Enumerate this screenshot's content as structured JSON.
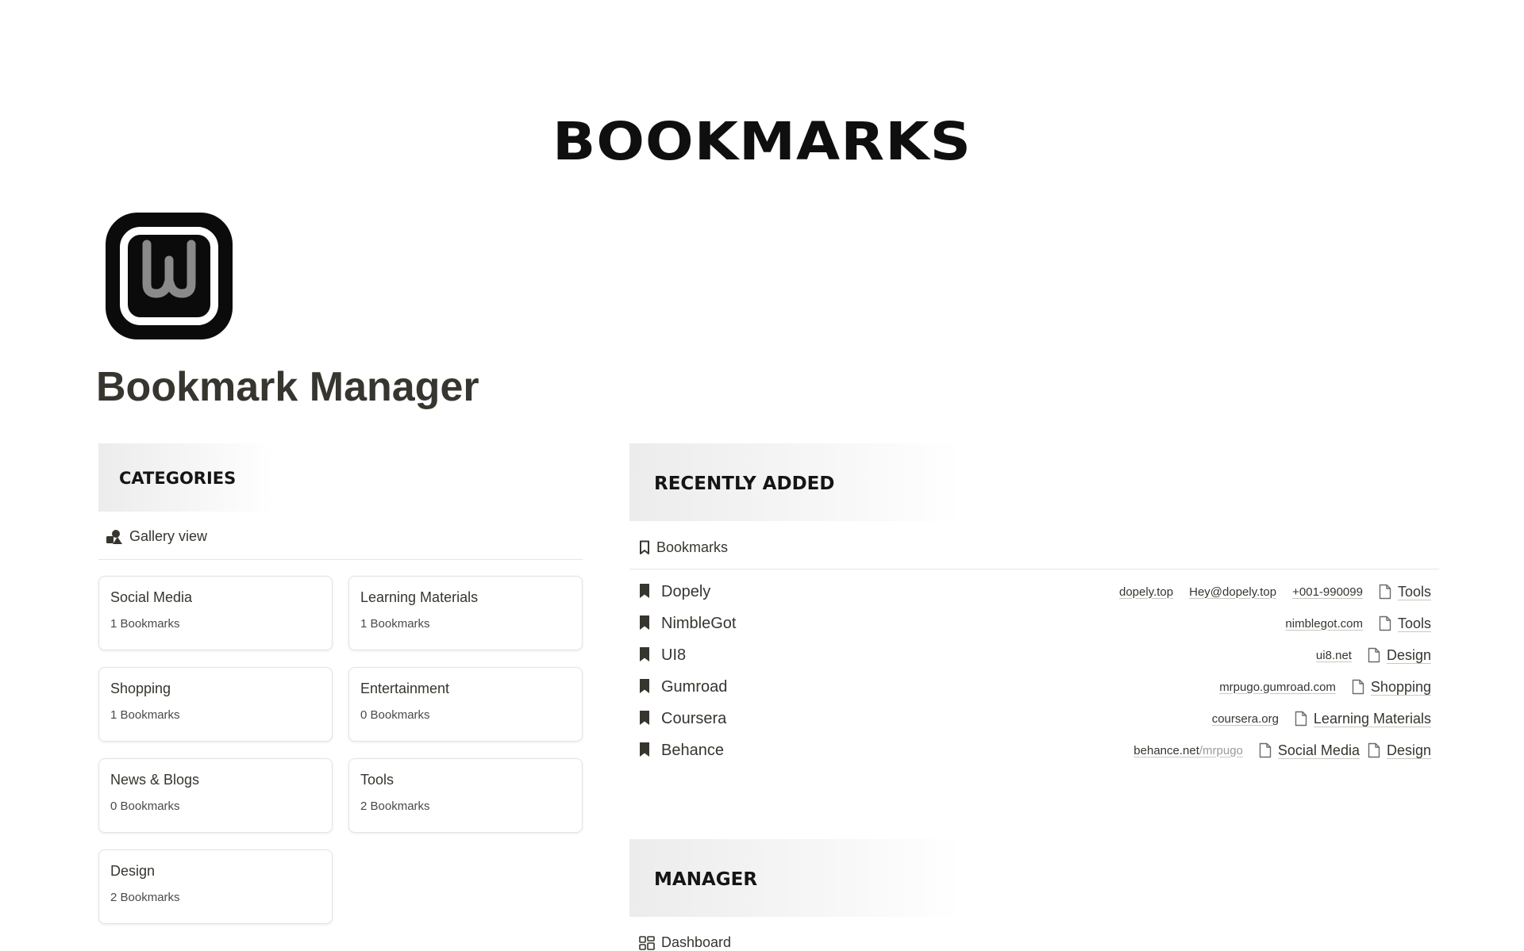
{
  "hero": {
    "title": "BOOKMARKS"
  },
  "page": {
    "title": "Bookmark Manager"
  },
  "categories": {
    "header": "CATEGORIES",
    "view_label": "Gallery view",
    "cards": [
      {
        "title": "Social Media",
        "count": "1 Bookmarks"
      },
      {
        "title": "Learning Materials",
        "count": "1 Bookmarks"
      },
      {
        "title": "Shopping",
        "count": "1 Bookmarks"
      },
      {
        "title": "Entertainment",
        "count": "0 Bookmarks"
      },
      {
        "title": "News & Blogs",
        "count": "0 Bookmarks"
      },
      {
        "title": "Tools",
        "count": "2 Bookmarks"
      },
      {
        "title": "Design",
        "count": "2 Bookmarks"
      }
    ]
  },
  "recent": {
    "header": "RECENTLY ADDED",
    "view_label": "Bookmarks",
    "rows": [
      {
        "name": "Dopely",
        "url": "dopely.top",
        "email": "Hey@dopely.top",
        "phone": "+001-990099",
        "categories": [
          "Tools"
        ]
      },
      {
        "name": "NimbleGot",
        "url": "nimblegot.com",
        "categories": [
          "Tools"
        ]
      },
      {
        "name": "UI8",
        "url": "ui8.net",
        "categories": [
          "Design"
        ]
      },
      {
        "name": "Gumroad",
        "url": "mrpugo.gumroad.com",
        "categories": [
          "Shopping"
        ]
      },
      {
        "name": "Coursera",
        "url": "coursera.org",
        "categories": [
          "Learning Materials"
        ]
      },
      {
        "name": "Behance",
        "url": "behance.net",
        "url_suffix": "/mrpugo",
        "categories": [
          "Social Media",
          "Design"
        ]
      }
    ]
  },
  "manager": {
    "header": "MANAGER",
    "view_label": "Dashboard"
  },
  "icons": {
    "page_icon": "w-app-icon",
    "gallery": "shapes-icon",
    "bookmark": "bookmark-icon",
    "page": "page-icon",
    "dashboard": "grid-icon"
  },
  "colors": {
    "text": "#37352f",
    "heading": "#151515",
    "border": "#e3e3e1"
  }
}
